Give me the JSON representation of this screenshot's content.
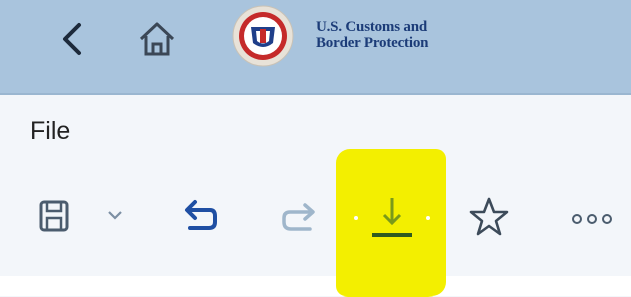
{
  "header": {
    "brand_line1": "U.S. Customs and",
    "brand_line2": "Border Protection",
    "icons": [
      "back-icon",
      "home-icon",
      "cbp-seal-logo"
    ]
  },
  "menu": {
    "title": "File"
  },
  "toolbar": {
    "items": [
      "save-icon",
      "dropdown-chevron-icon",
      "undo-icon",
      "redo-icon",
      "download-icon",
      "favorite-star-icon",
      "more-options-icon"
    ]
  },
  "colors": {
    "header_bg": "#a9c4dd",
    "brand_text": "#1c3c78",
    "highlight": "#f3ef00",
    "icon_dark": "#4b5c6e",
    "icon_blue": "#1f4fa3",
    "icon_disabled": "#9fb6cb"
  }
}
